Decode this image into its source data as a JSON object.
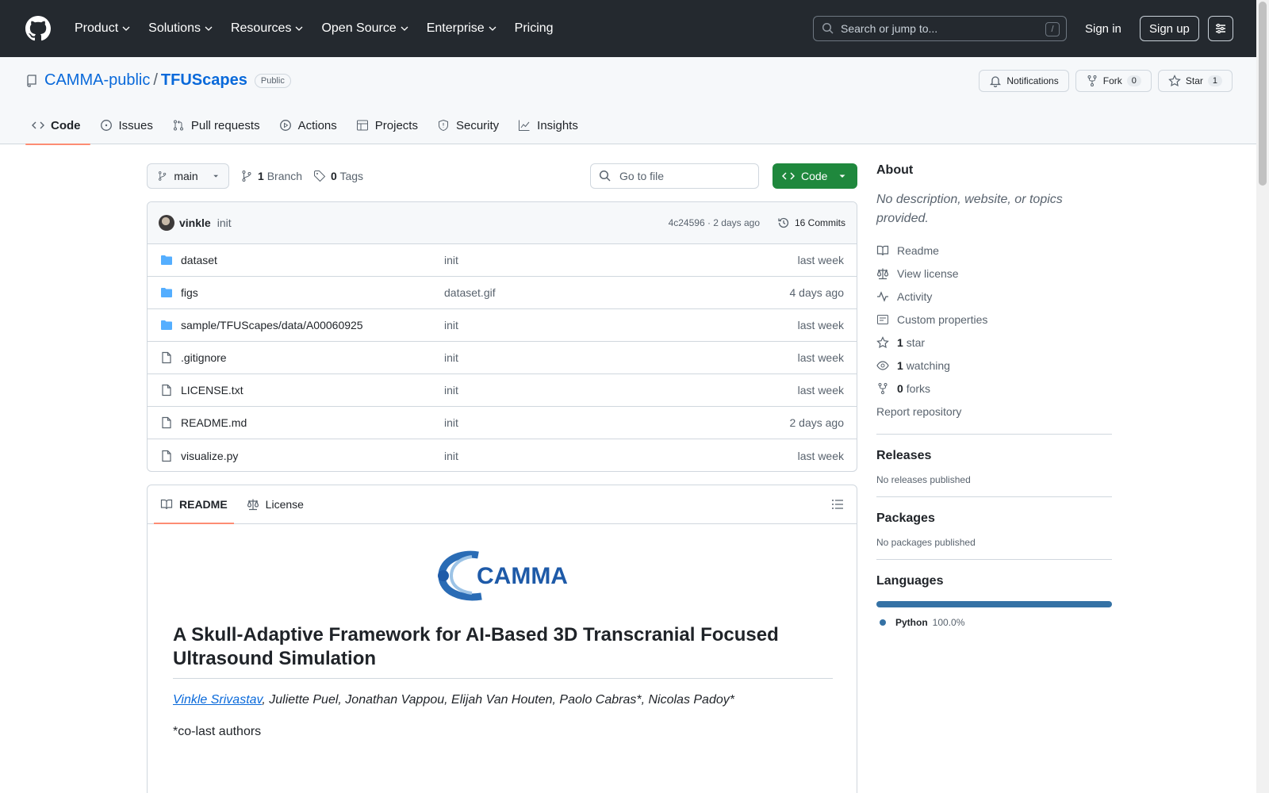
{
  "header": {
    "nav": [
      "Product",
      "Solutions",
      "Resources",
      "Open Source",
      "Enterprise",
      "Pricing"
    ],
    "search_placeholder": "Search or jump to...",
    "search_key": "/",
    "signin": "Sign in",
    "signup": "Sign up"
  },
  "repo": {
    "owner": "CAMMA-public",
    "separator": "/",
    "name": "TFUScapes",
    "visibility": "Public",
    "notifications": "Notifications",
    "fork": "Fork",
    "fork_count": "0",
    "star": "Star",
    "star_count": "1"
  },
  "tabs": [
    "Code",
    "Issues",
    "Pull requests",
    "Actions",
    "Projects",
    "Security",
    "Insights"
  ],
  "branch": {
    "name": "main",
    "branch_count": "1",
    "branch_label": "Branch",
    "tag_count": "0",
    "tag_label": "Tags",
    "goto_placeholder": "Go to file",
    "code_button": "Code"
  },
  "commit": {
    "author": "vinkle",
    "message": "init",
    "meta": "4c24596 · 2 days ago",
    "count": "16 Commits"
  },
  "files": [
    {
      "type": "folder",
      "name": "dataset",
      "message": "init",
      "date": "last week"
    },
    {
      "type": "folder",
      "name": "figs",
      "message": "dataset.gif",
      "date": "4 days ago"
    },
    {
      "type": "folder",
      "name": "sample/TFUScapes/data/A00060925",
      "message": "init",
      "date": "last week"
    },
    {
      "type": "file",
      "name": ".gitignore",
      "message": "init",
      "date": "last week"
    },
    {
      "type": "file",
      "name": "LICENSE.txt",
      "message": "init",
      "date": "last week"
    },
    {
      "type": "file",
      "name": "README.md",
      "message": "init",
      "date": "2 days ago"
    },
    {
      "type": "file",
      "name": "visualize.py",
      "message": "init",
      "date": "last week"
    }
  ],
  "readme": {
    "tab_readme": "README",
    "tab_license": "License",
    "logo_text": "CAMMA",
    "title": "A Skull-Adaptive Framework for AI-Based 3D Transcranial Focused Ultrasound Simulation",
    "author_link": "Vinkle Srivastav",
    "authors_rest": ", Juliette Puel, Jonathan Vappou, Elijah Van Houten, Paolo Cabras*, Nicolas Padoy*",
    "note": "*co-last authors"
  },
  "sidebar": {
    "about_title": "About",
    "about_desc": "No description, website, or topics provided.",
    "readme": "Readme",
    "license": "View license",
    "activity": "Activity",
    "custom_props": "Custom properties",
    "stars_count": "1",
    "stars_label": "star",
    "watching_count": "1",
    "watching_label": "watching",
    "forks_count": "0",
    "forks_label": "forks",
    "report": "Report repository",
    "releases_title": "Releases",
    "releases_text": "No releases published",
    "packages_title": "Packages",
    "packages_text": "No packages published",
    "languages_title": "Languages",
    "language_name": "Python",
    "language_pct": "100.0%"
  },
  "colors": {
    "header_bg": "#24292f",
    "link": "#0969da",
    "code_button": "#1f883d",
    "python": "#3572A5",
    "tab_underline": "#fd8c73"
  }
}
